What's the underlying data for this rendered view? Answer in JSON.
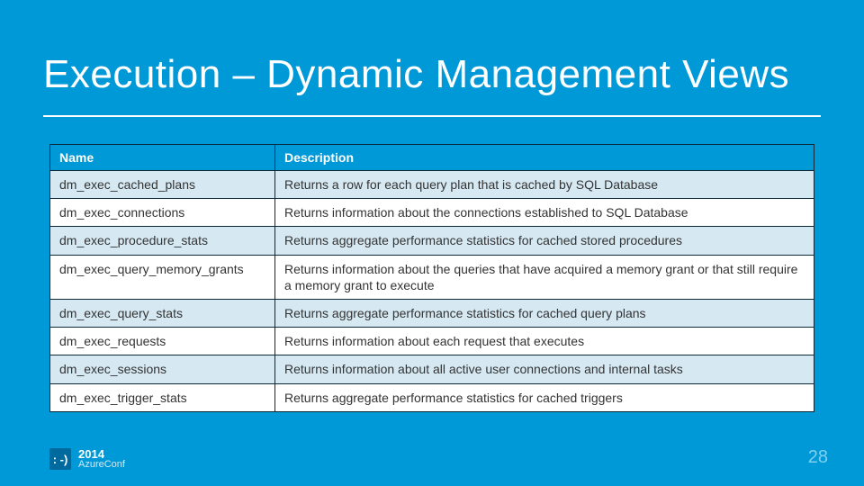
{
  "slide": {
    "title": "Execution – Dynamic Management Views",
    "page_number": "28"
  },
  "table": {
    "headers": {
      "name": "Name",
      "desc": "Description"
    },
    "rows": [
      {
        "name": "dm_exec_cached_plans",
        "desc": "Returns a row for each query plan that is cached by SQL Database"
      },
      {
        "name": "dm_exec_connections",
        "desc": "Returns information about the connections established to SQL Database"
      },
      {
        "name": "dm_exec_procedure_stats",
        "desc": "Returns aggregate performance statistics for cached stored procedures"
      },
      {
        "name": "dm_exec_query_memory_grants",
        "desc": "Returns information about the queries that have acquired a memory grant or that still require a memory grant to execute"
      },
      {
        "name": "dm_exec_query_stats",
        "desc": "Returns aggregate performance statistics for cached query plans"
      },
      {
        "name": "dm_exec_requests",
        "desc": "Returns information about each request that executes"
      },
      {
        "name": "dm_exec_sessions",
        "desc": "Returns information about all active user connections and internal tasks"
      },
      {
        "name": "dm_exec_trigger_stats",
        "desc": "Returns aggregate performance statistics for cached triggers"
      }
    ]
  },
  "footer": {
    "badge": ": -)",
    "year": "2014",
    "conf": "AzureConf"
  }
}
